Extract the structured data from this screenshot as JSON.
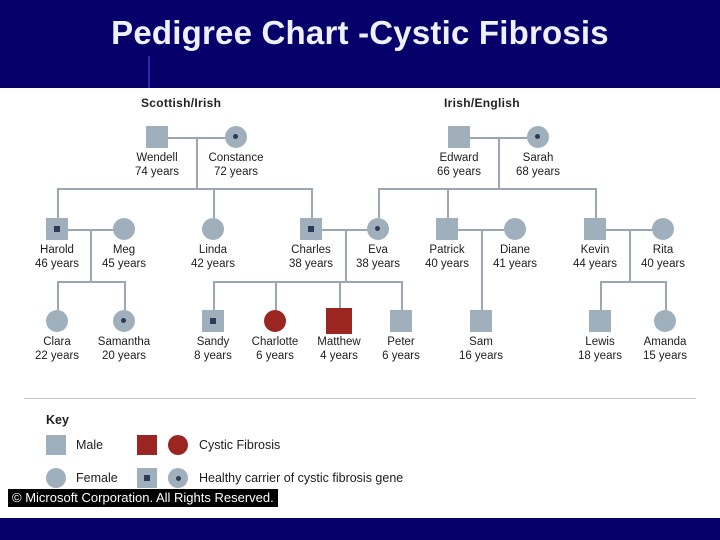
{
  "slide": {
    "title": "Pedigree Chart -Cystic Fibrosis",
    "copyright": "© Microsoft Corporation. All Rights Reserved.",
    "title_band_color": "#06006b",
    "symbol_color": "#9fb0bc",
    "affected_color": "#9b2520",
    "line_color": "#9aa7b2"
  },
  "groups": [
    {
      "label": "Scottish/Irish"
    },
    {
      "label": "Irish/English"
    }
  ],
  "generations": [
    {
      "name": "generation-1",
      "people": [
        {
          "id": "wendell",
          "name": "Wendell",
          "age": "74 years",
          "sex": "male",
          "status": "unaffected"
        },
        {
          "id": "constance",
          "name": "Constance",
          "age": "72 years",
          "sex": "female",
          "status": "carrier"
        },
        {
          "id": "edward",
          "name": "Edward",
          "age": "66 years",
          "sex": "male",
          "status": "unaffected"
        },
        {
          "id": "sarah",
          "name": "Sarah",
          "age": "68 years",
          "sex": "female",
          "status": "carrier"
        }
      ]
    },
    {
      "name": "generation-2",
      "people": [
        {
          "id": "harold",
          "name": "Harold",
          "age": "46 years",
          "sex": "male",
          "status": "carrier"
        },
        {
          "id": "meg",
          "name": "Meg",
          "age": "45 years",
          "sex": "female",
          "status": "unaffected"
        },
        {
          "id": "linda",
          "name": "Linda",
          "age": "42 years",
          "sex": "female",
          "status": "unaffected"
        },
        {
          "id": "charles",
          "name": "Charles",
          "age": "38 years",
          "sex": "male",
          "status": "carrier"
        },
        {
          "id": "eva",
          "name": "Eva",
          "age": "38 years",
          "sex": "female",
          "status": "carrier"
        },
        {
          "id": "patrick",
          "name": "Patrick",
          "age": "40 years",
          "sex": "male",
          "status": "unaffected"
        },
        {
          "id": "diane",
          "name": "Diane",
          "age": "41 years",
          "sex": "female",
          "status": "unaffected"
        },
        {
          "id": "kevin",
          "name": "Kevin",
          "age": "44 years",
          "sex": "male",
          "status": "unaffected"
        },
        {
          "id": "rita",
          "name": "Rita",
          "age": "40 years",
          "sex": "female",
          "status": "unaffected"
        }
      ]
    },
    {
      "name": "generation-3",
      "people": [
        {
          "id": "clara",
          "name": "Clara",
          "age": "22 years",
          "sex": "female",
          "status": "unaffected"
        },
        {
          "id": "samantha",
          "name": "Samantha",
          "age": "20 years",
          "sex": "female",
          "status": "carrier"
        },
        {
          "id": "sandy",
          "name": "Sandy",
          "age": "8 years",
          "sex": "male",
          "status": "carrier"
        },
        {
          "id": "charlotte",
          "name": "Charlotte",
          "age": "6 years",
          "sex": "female",
          "status": "affected"
        },
        {
          "id": "matthew",
          "name": "Matthew",
          "age": "4 years",
          "sex": "male",
          "status": "affected"
        },
        {
          "id": "peter",
          "name": "Peter",
          "age": "6 years",
          "sex": "male",
          "status": "unaffected"
        },
        {
          "id": "sam",
          "name": "Sam",
          "age": "16 years",
          "sex": "male",
          "status": "unaffected"
        },
        {
          "id": "lewis",
          "name": "Lewis",
          "age": "18 years",
          "sex": "male",
          "status": "unaffected"
        },
        {
          "id": "amanda",
          "name": "Amanda",
          "age": "15 years",
          "sex": "female",
          "status": "unaffected"
        }
      ]
    }
  ],
  "key": {
    "title": "Key",
    "entries": [
      {
        "id": "male",
        "label": "Male"
      },
      {
        "id": "female",
        "label": "Female"
      },
      {
        "id": "affected",
        "label": "Cystic Fibrosis"
      },
      {
        "id": "carrier",
        "label": "Healthy carrier of cystic fibrosis gene"
      }
    ]
  }
}
